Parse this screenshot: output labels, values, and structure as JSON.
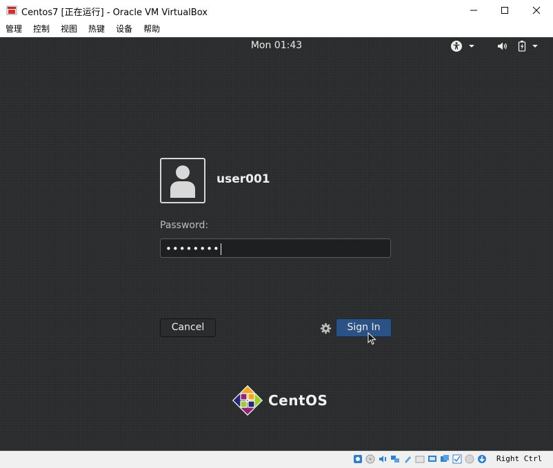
{
  "window": {
    "title": "Centos7 [正在运行] - Oracle VM VirtualBox"
  },
  "menubar": {
    "items": [
      {
        "label": "管理"
      },
      {
        "label": "控制"
      },
      {
        "label": "视图"
      },
      {
        "label": "热键"
      },
      {
        "label": "设备"
      },
      {
        "label": "帮助"
      }
    ]
  },
  "gnome": {
    "clock": "Mon 01:43",
    "tray_icons": [
      "accessibility-icon",
      "volume-icon",
      "battery-icon"
    ]
  },
  "login": {
    "username": "user001",
    "password_label": "Password:",
    "password_value": "••••••••",
    "cancel_label": "Cancel",
    "signin_label": "Sign In",
    "brand": "CentOS"
  },
  "statusbar": {
    "host_key": "Right Ctrl",
    "icons": [
      "hard-disk-icon",
      "optical-drive-icon",
      "audio-icon",
      "network-icon",
      "usb-icon",
      "shared-folders-icon",
      "display-icon",
      "video-capture-icon",
      "mouse-integration-icon",
      "cpu-icon",
      "host-key-icon"
    ]
  },
  "colors": {
    "vm_background": "#2b2d2e",
    "signin_button": "#2a5284",
    "titlebar": "#ffffff"
  }
}
